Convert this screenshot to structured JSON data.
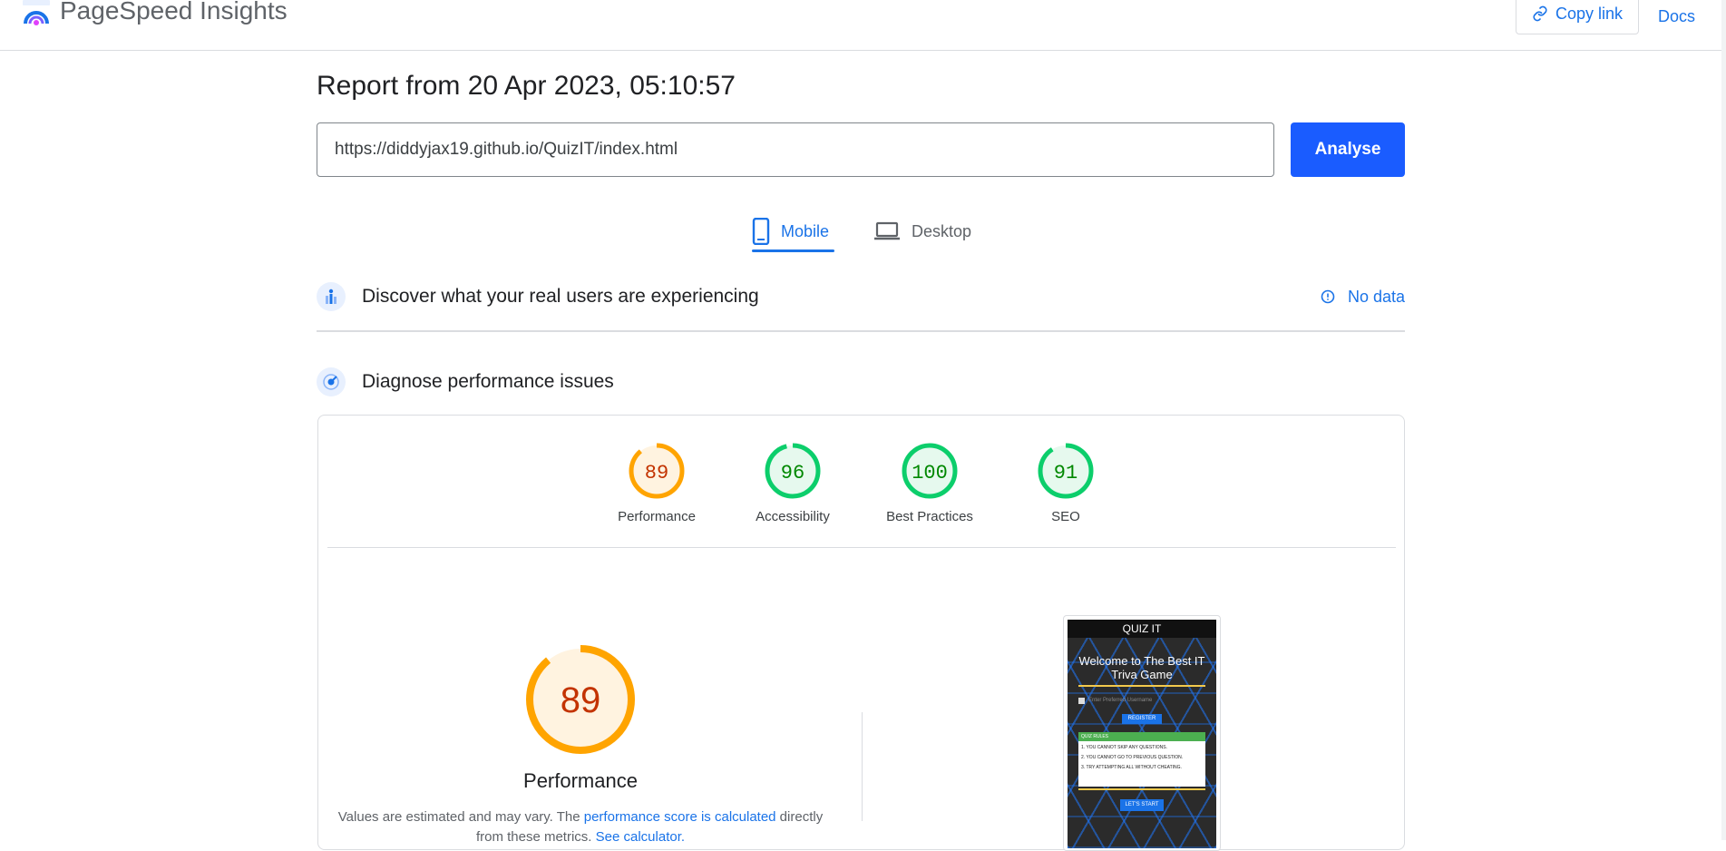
{
  "header": {
    "app_name": "PageSpeed Insights",
    "copy_link_label": "Copy link",
    "docs_label": "Docs"
  },
  "report": {
    "title": "Report from 20 Apr 2023, 05:10:57",
    "url_value": "https://diddyjax19.github.io/QuizIT/index.html",
    "analyse_label": "Analyse"
  },
  "tabs": [
    {
      "label": "Mobile",
      "active": true
    },
    {
      "label": "Desktop",
      "active": false
    }
  ],
  "field_data": {
    "title": "Discover what your real users are experiencing",
    "status": "No data"
  },
  "diagnose": {
    "title": "Diagnose performance issues"
  },
  "scores": [
    {
      "label": "Performance",
      "value": "89",
      "color": "#ffa400",
      "text_color": "#c33300",
      "fill": "#fff3e0"
    },
    {
      "label": "Accessibility",
      "value": "96",
      "color": "#0cce6b",
      "text_color": "#008800",
      "fill": "#e6f9ee"
    },
    {
      "label": "Best Practices",
      "value": "100",
      "color": "#0cce6b",
      "text_color": "#008800",
      "fill": "#e6f9ee"
    },
    {
      "label": "SEO",
      "value": "91",
      "color": "#0cce6b",
      "text_color": "#008800",
      "fill": "#e6f9ee"
    }
  ],
  "performance_detail": {
    "value": "89",
    "label": "Performance",
    "note_prefix": "Values are estimated and may vary. The ",
    "note_link1": "performance score is calculated",
    "note_middle": " directly from these metrics. ",
    "note_link2": "See calculator."
  },
  "screenshot": {
    "title": "QUIZ IT",
    "welcome": "Welcome to The Best IT Triva Game",
    "input_placeholder": "Enter Preferred Username",
    "register_label": "REGISTER",
    "rules_heading": "QUIZ RULES",
    "rules": [
      "1. YOU CANNOT SKIP ANY QUESTIONS.",
      "2. YOU CANNOT GO TO PREVIOUS QUESTION.",
      "3. TRY ATTEMPTING ALL WITHOUT CHEATING."
    ],
    "start_label": "LET'S START"
  }
}
